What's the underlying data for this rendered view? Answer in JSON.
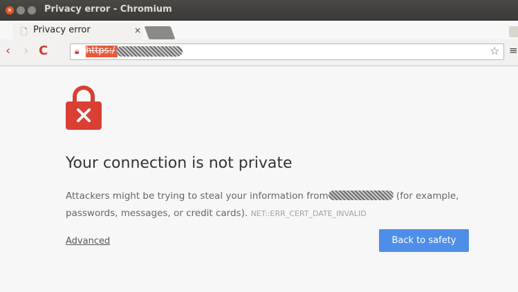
{
  "window": {
    "title": "Privacy error - Chromium",
    "close_glyph": "×"
  },
  "tab": {
    "title": "Privacy error",
    "icon": "page-icon",
    "close_glyph": "×"
  },
  "toolbar": {
    "back_glyph": "‹",
    "forward_glyph": "›",
    "reload_glyph": "C",
    "url_prefix": "https:/",
    "star_glyph": "☆",
    "menu_glyph": "≡"
  },
  "page": {
    "heading": "Your connection is not private",
    "para_start": "Attackers might be trying to steal your information from",
    "para_end": " (for example, passwords, messages, or credit cards). ",
    "error_code": "NET::ERR_CERT_DATE_INVALID",
    "advanced_link": "Advanced",
    "safety_button": "Back to safety"
  },
  "colors": {
    "accent_red": "#d93f32",
    "button_blue": "#4f8ee8"
  }
}
